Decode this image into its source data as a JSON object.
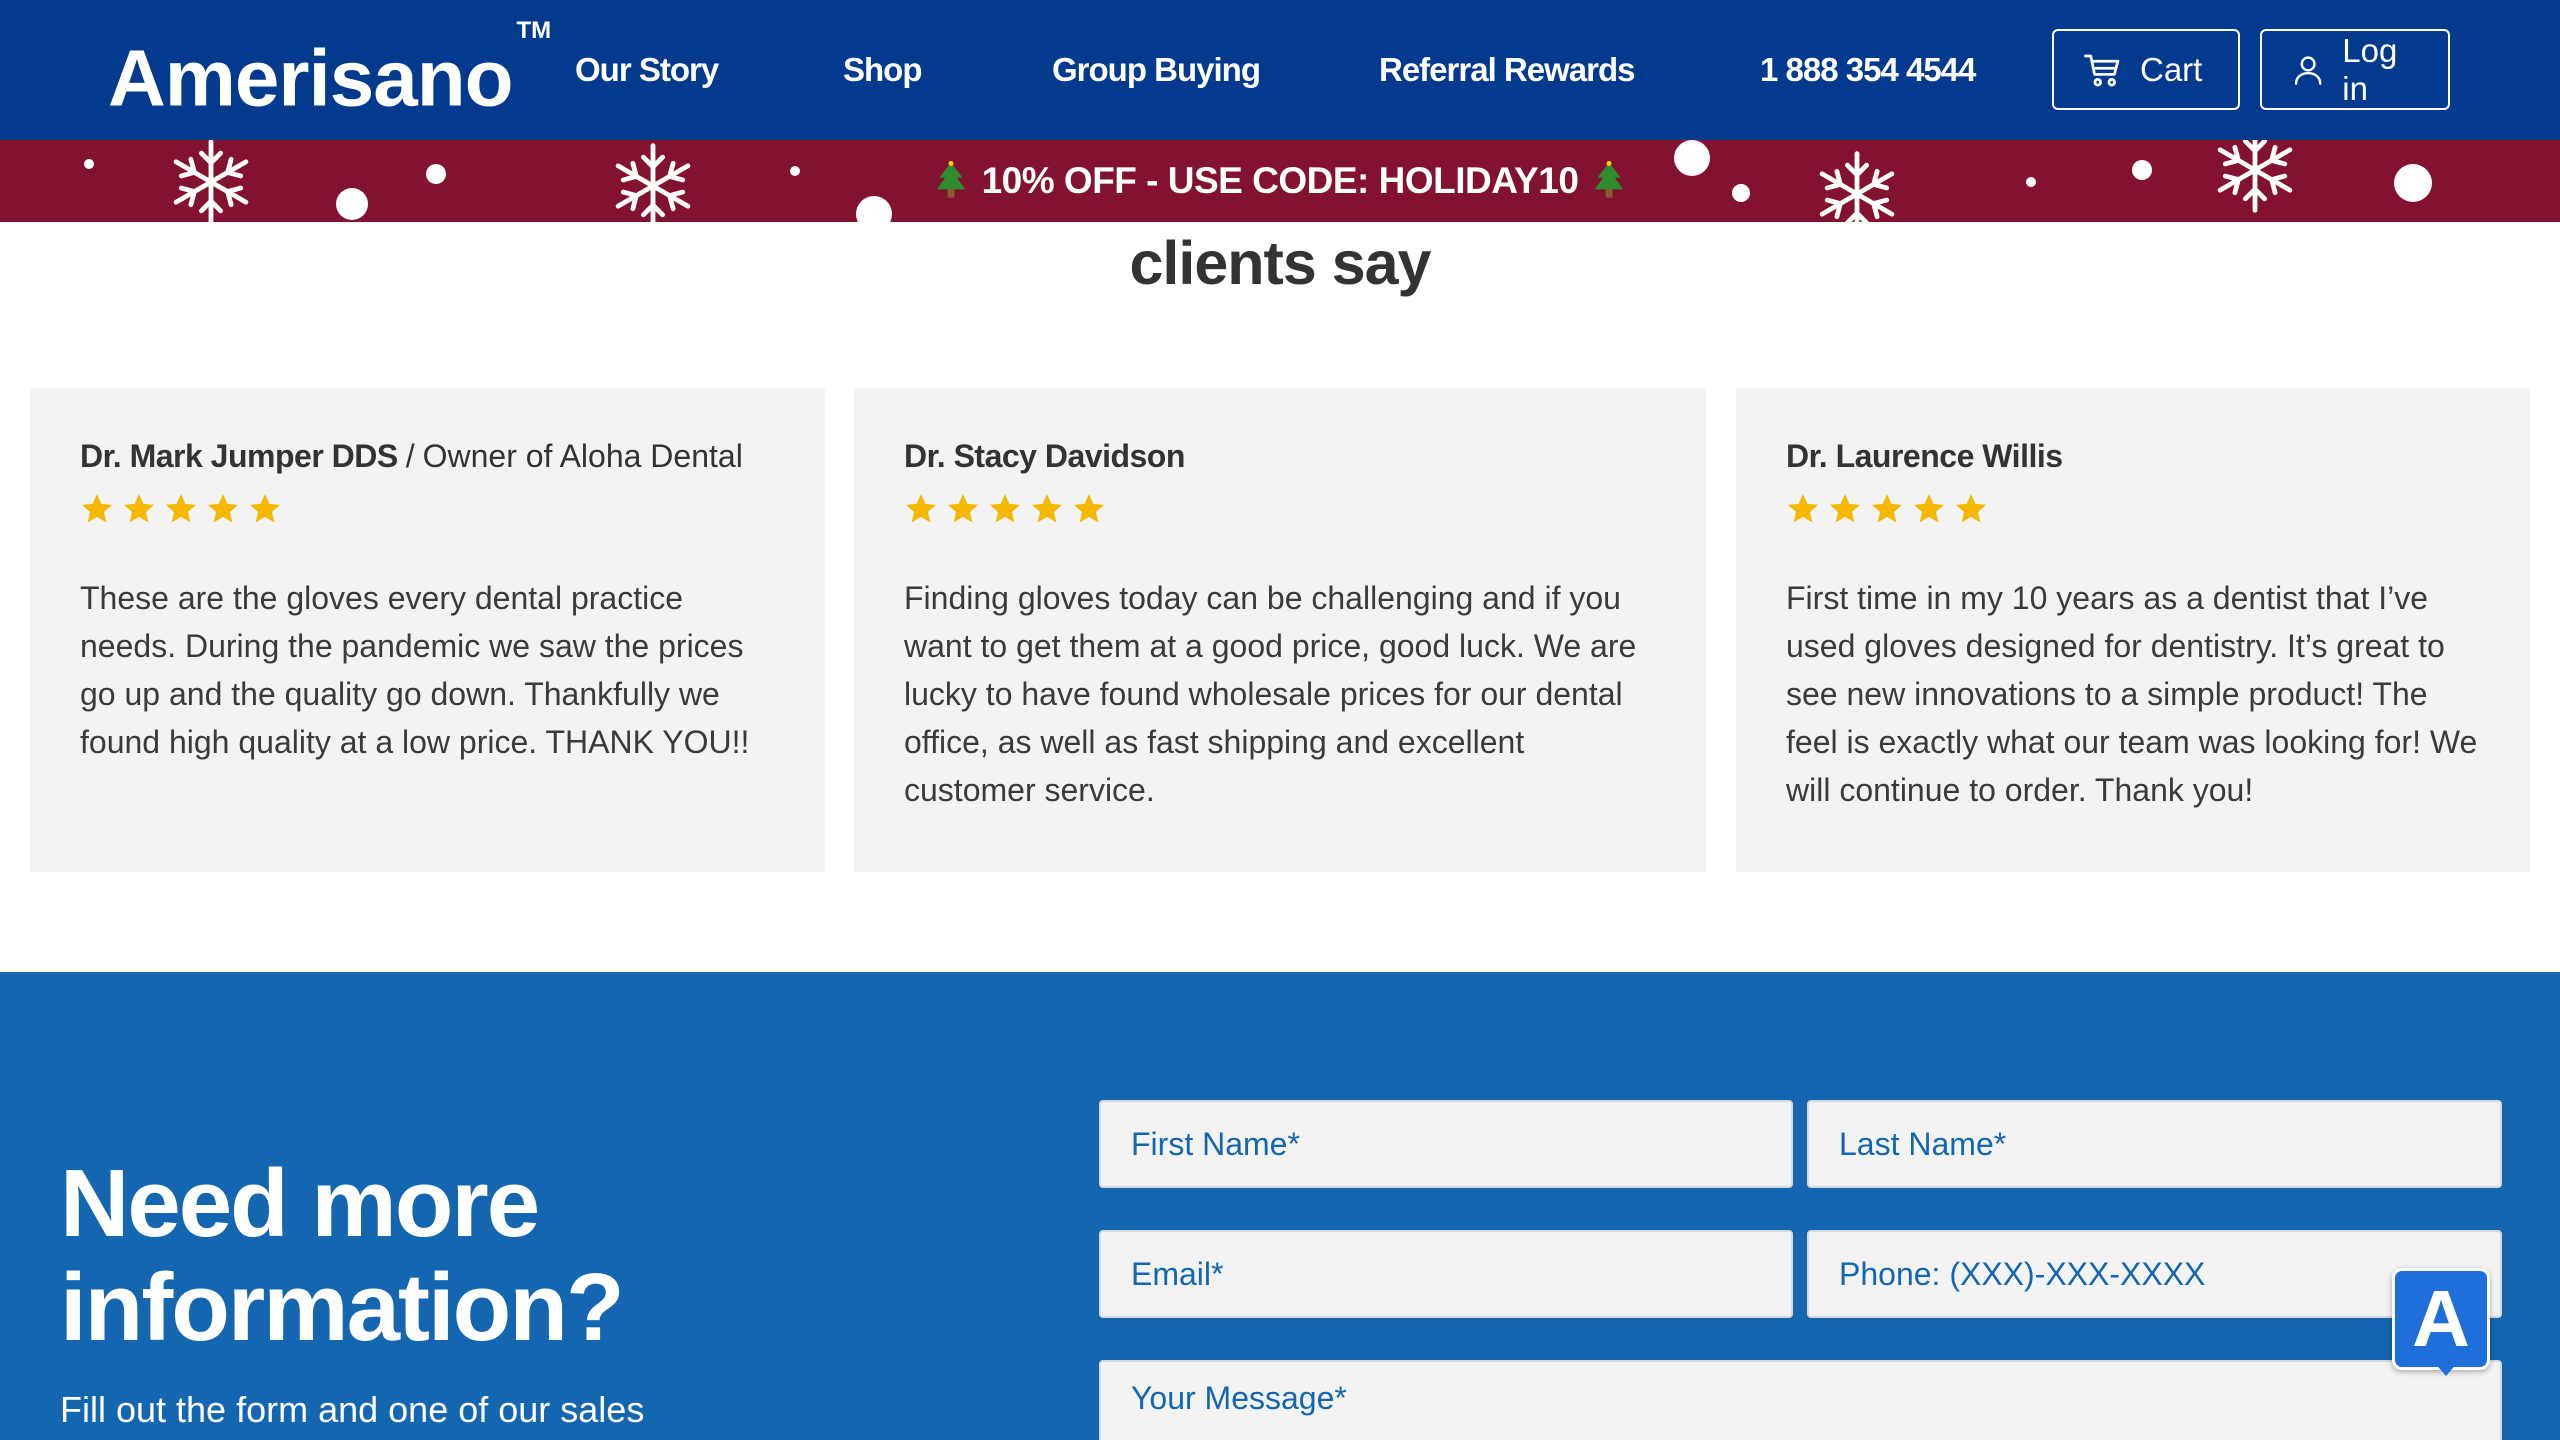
{
  "header": {
    "logo": "Amerisano",
    "logo_mark": "TM",
    "nav": [
      "Our Story",
      "Shop",
      "Group Buying",
      "Referral Rewards"
    ],
    "phone": "1 888 354 4544",
    "cart_label": "Cart",
    "login_label": "Log in",
    "cart_icon": "cart-icon",
    "login_icon": "user-icon"
  },
  "promo": {
    "text": "10% OFF - USE CODE: HOLIDAY10",
    "icon": "christmas-tree-icon",
    "background": "#831230"
  },
  "testimonials": {
    "title": "clients say",
    "items": [
      {
        "name": "Dr. Mark Jumper DDS",
        "separator": "/",
        "role": "Owner of Aloha Dental",
        "rating": 5,
        "text": "These are the gloves every dental practice needs. During the pandemic we saw the prices go up and the quality go down. Thankfully we found high quality at a low price. THANK YOU!!"
      },
      {
        "name": "Dr. Stacy Davidson",
        "rating": 5,
        "text": "Finding gloves today can be challenging and if you want to get them at a good price, good luck. We are lucky to have found wholesale prices for our dental office, as well as fast shipping and excellent customer service."
      },
      {
        "name": "Dr. Laurence Willis",
        "rating": 5,
        "text": "First time in my 10 years as a dentist that I’ve used gloves designed for dentistry. It’s great to see new innovations to a simple product! The feel is exactly what our team was looking for! We will continue to order. Thank you!"
      }
    ]
  },
  "contact": {
    "title": "Need more information?",
    "subtitle": "Fill out the form and one of our sales",
    "fields": {
      "first_name": "First Name*",
      "last_name": "Last Name*",
      "email": "Email*",
      "phone": "Phone: (XXX)-XXX-XXXX",
      "message": "Your Message*"
    }
  },
  "accessibility_widget": {
    "label": "A",
    "icon": "accessibility-icon"
  },
  "colors": {
    "header": "#033a8e",
    "promo": "#831230",
    "contact": "#1466b0",
    "star": "#f5b800",
    "card": "#f3f3f3"
  }
}
